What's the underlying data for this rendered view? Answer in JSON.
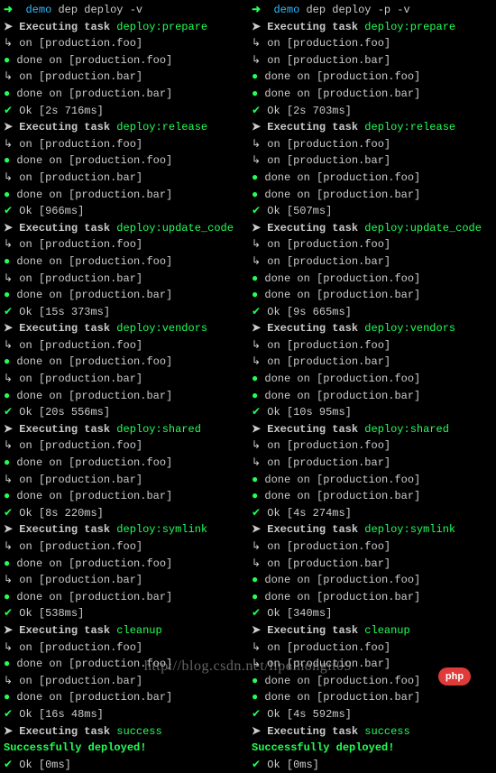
{
  "watermark": "http://blog.csdn.net/lipeihongit09",
  "php_badge": "php",
  "glyphs": {
    "prompt_arrow": "➜",
    "exec_arrow": "➤",
    "sub_arrow": "↳",
    "dot": "●",
    "tick": "✔"
  },
  "left": {
    "prompt_dir": "demo",
    "prompt_cmd": "dep deploy -v",
    "sections": [
      {
        "task": "deploy:prepare",
        "lines": [
          {
            "t": "on",
            "h": "[production.foo]"
          },
          {
            "t": "done",
            "h": "[production.foo]"
          },
          {
            "t": "on",
            "h": "[production.bar]"
          },
          {
            "t": "done",
            "h": "[production.bar]"
          }
        ],
        "ok": "Ok [2s 716ms]"
      },
      {
        "task": "deploy:release",
        "lines": [
          {
            "t": "on",
            "h": "[production.foo]"
          },
          {
            "t": "done",
            "h": "[production.foo]"
          },
          {
            "t": "on",
            "h": "[production.bar]"
          },
          {
            "t": "done",
            "h": "[production.bar]"
          }
        ],
        "ok": "Ok [966ms]"
      },
      {
        "task": "deploy:update_code",
        "lines": [
          {
            "t": "on",
            "h": "[production.foo]"
          },
          {
            "t": "done",
            "h": "[production.foo]"
          },
          {
            "t": "on",
            "h": "[production.bar]"
          },
          {
            "t": "done",
            "h": "[production.bar]"
          }
        ],
        "ok": "Ok [15s 373ms]"
      },
      {
        "task": "deploy:vendors",
        "lines": [
          {
            "t": "on",
            "h": "[production.foo]"
          },
          {
            "t": "done",
            "h": "[production.foo]"
          },
          {
            "t": "on",
            "h": "[production.bar]"
          },
          {
            "t": "done",
            "h": "[production.bar]"
          }
        ],
        "ok": "Ok [20s 556ms]"
      },
      {
        "task": "deploy:shared",
        "lines": [
          {
            "t": "on",
            "h": "[production.foo]"
          },
          {
            "t": "done",
            "h": "[production.foo]"
          },
          {
            "t": "on",
            "h": "[production.bar]"
          },
          {
            "t": "done",
            "h": "[production.bar]"
          }
        ],
        "ok": "Ok [8s 220ms]"
      },
      {
        "task": "deploy:symlink",
        "lines": [
          {
            "t": "on",
            "h": "[production.foo]"
          },
          {
            "t": "done",
            "h": "[production.foo]"
          },
          {
            "t": "on",
            "h": "[production.bar]"
          },
          {
            "t": "done",
            "h": "[production.bar]"
          }
        ],
        "ok": "Ok [538ms]"
      },
      {
        "task": "cleanup",
        "lines": [
          {
            "t": "on",
            "h": "[production.foo]"
          },
          {
            "t": "done",
            "h": "[production.foo]"
          },
          {
            "t": "on",
            "h": "[production.bar]"
          },
          {
            "t": "done",
            "h": "[production.bar]"
          }
        ],
        "ok": "Ok [16s 48ms]"
      },
      {
        "task": "success",
        "lines": [],
        "success": "Successfully deployed!",
        "ok": "Ok [0ms]"
      }
    ]
  },
  "right": {
    "prompt_dir": "demo",
    "prompt_cmd": "dep deploy -p -v",
    "sections": [
      {
        "task": "deploy:prepare",
        "lines": [
          {
            "t": "on",
            "h": "[production.foo]"
          },
          {
            "t": "on",
            "h": "[production.bar]"
          },
          {
            "t": "done",
            "h": "[production.foo]"
          },
          {
            "t": "done",
            "h": "[production.bar]"
          }
        ],
        "ok": "Ok [2s 703ms]"
      },
      {
        "task": "deploy:release",
        "lines": [
          {
            "t": "on",
            "h": "[production.foo]"
          },
          {
            "t": "on",
            "h": "[production.bar]"
          },
          {
            "t": "done",
            "h": "[production.foo]"
          },
          {
            "t": "done",
            "h": "[production.bar]"
          }
        ],
        "ok": "Ok [507ms]"
      },
      {
        "task": "deploy:update_code",
        "lines": [
          {
            "t": "on",
            "h": "[production.foo]"
          },
          {
            "t": "on",
            "h": "[production.bar]"
          },
          {
            "t": "done",
            "h": "[production.foo]"
          },
          {
            "t": "done",
            "h": "[production.bar]"
          }
        ],
        "ok": "Ok [9s 665ms]"
      },
      {
        "task": "deploy:vendors",
        "lines": [
          {
            "t": "on",
            "h": "[production.foo]"
          },
          {
            "t": "on",
            "h": "[production.bar]"
          },
          {
            "t": "done",
            "h": "[production.foo]"
          },
          {
            "t": "done",
            "h": "[production.bar]"
          }
        ],
        "ok": "Ok [10s 95ms]"
      },
      {
        "task": "deploy:shared",
        "lines": [
          {
            "t": "on",
            "h": "[production.foo]"
          },
          {
            "t": "on",
            "h": "[production.bar]"
          },
          {
            "t": "done",
            "h": "[production.foo]"
          },
          {
            "t": "done",
            "h": "[production.bar]"
          }
        ],
        "ok": "Ok [4s 274ms]"
      },
      {
        "task": "deploy:symlink",
        "lines": [
          {
            "t": "on",
            "h": "[production.foo]"
          },
          {
            "t": "on",
            "h": "[production.bar]"
          },
          {
            "t": "done",
            "h": "[production.foo]"
          },
          {
            "t": "done",
            "h": "[production.bar]"
          }
        ],
        "ok": "Ok [340ms]"
      },
      {
        "task": "cleanup",
        "lines": [
          {
            "t": "on",
            "h": "[production.foo]"
          },
          {
            "t": "on",
            "h": "[production.bar]"
          },
          {
            "t": "done",
            "h": "[production.foo]"
          },
          {
            "t": "done",
            "h": "[production.bar]"
          }
        ],
        "ok": "Ok [4s 592ms]"
      },
      {
        "task": "success",
        "lines": [],
        "success": "Successfully deployed!",
        "ok": "Ok [0ms]"
      }
    ]
  }
}
